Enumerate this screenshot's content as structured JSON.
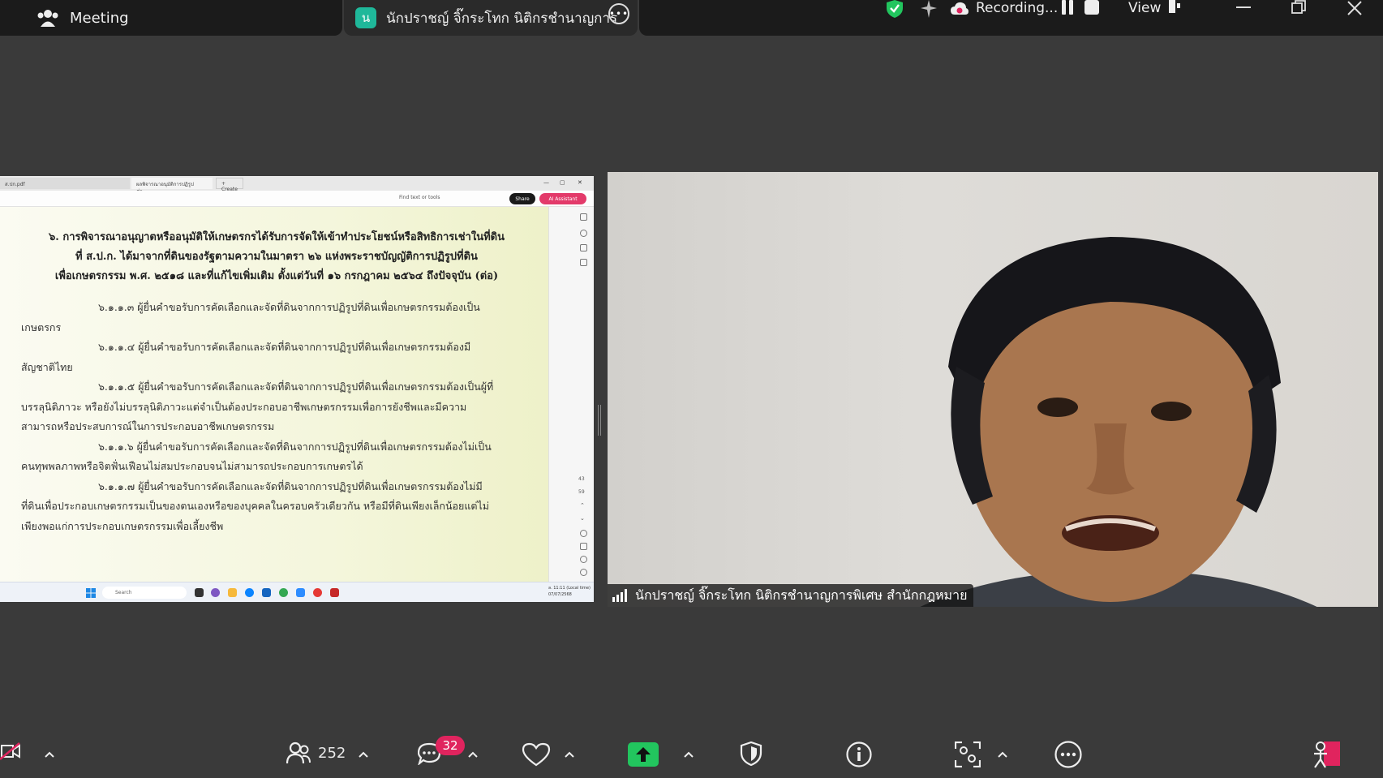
{
  "topbar": {
    "meeting_label": "Meeting",
    "speaker_avatar_letter": "น",
    "speaker_tab_name": "นักปราชญ์ จิ๊กระโทก นิติกรชำนาญการ",
    "recording_label": "Recording...",
    "view_label": "View"
  },
  "shared_screen": {
    "tabs": [
      "ส.ปก.pdf",
      "ผลพิจารณาอนุมัติการปฏิรูปที่ดิน...",
      "+ Create"
    ],
    "find_placeholder": "Find text or tools",
    "share_button": "Share",
    "ai_button": "AI Assistant",
    "heading_lines": [
      "๖. การพิจารณาอนุญาตหรืออนุมัติให้เกษตรกรได้รับการจัดให้เข้าทำประโยชน์หรือสิทธิการเช่าในที่ดิน",
      "ที่ ส.ป.ก. ได้มาจากที่ดินของรัฐตามความในมาตรา ๒๖ แห่งพระราชบัญญัติการปฏิรูปที่ดิน",
      "เพื่อเกษตรกรรม พ.ศ. ๒๕๑๘ และที่แก้ไขเพิ่มเติม ตั้งแต่วันที่ ๑๖ กรกฎาคม ๒๕๖๔ ถึงปัจจุบัน (ต่อ)"
    ],
    "paragraphs": [
      "๖.๑.๑.๓ ผู้ยื่นคำขอรับการคัดเลือกและจัดที่ดินจากการปฏิรูปที่ดินเพื่อเกษตรกรรมต้องเป็นเกษตรกร",
      "๖.๑.๑.๔ ผู้ยื่นคำขอรับการคัดเลือกและจัดที่ดินจากการปฏิรูปที่ดินเพื่อเกษตรกรรมต้องมีสัญชาติไทย",
      "๖.๑.๑.๕ ผู้ยื่นคำขอรับการคัดเลือกและจัดที่ดินจากการปฏิรูปที่ดินเพื่อเกษตรกรรมต้องเป็นผู้ที่บรรลุนิติภาวะ หรือยังไม่บรรลุนิติภาวะแต่จำเป็นต้องประกอบอาชีพเกษตรกรรมเพื่อการยังชีพและมีความสามารถหรือประสบการณ์ในการประกอบอาชีพเกษตรกรรม",
      "๖.๑.๑.๖ ผู้ยื่นคำขอรับการคัดเลือกและจัดที่ดินจากการปฏิรูปที่ดินเพื่อเกษตรกรรมต้องไม่เป็นคนทุพพลภาพหรือจิตฟั่นเฟือนไม่สมประกอบจนไม่สามารถประกอบการเกษตรได้",
      "๖.๑.๑.๗ ผู้ยื่นคำขอรับการคัดเลือกและจัดที่ดินจากการปฏิรูปที่ดินเพื่อเกษตรกรรมต้องไม่มีที่ดินเพื่อประกอบเกษตรกรรมเป็นของตนเองหรือของบุคคลในครอบครัวเดียวกัน หรือมีที่ดินเพียงเล็กน้อยแต่ไม่เพียงพอแก่การประกอบเกษตรกรรมเพื่อเลี้ยงชีพ"
    ],
    "page_current": "43",
    "page_total": "59",
    "taskbar_search": "Search",
    "clock_time": "ล. 11:11 (Local time)",
    "clock_date": "07/07/2568"
  },
  "camera": {
    "name_tag": "นักปราชญ์ จิ๊กระโทก นิติกรชำนาญการพิเศษ สำนักกฎหมาย"
  },
  "bottombar": {
    "participants_count": "252",
    "chat_badge": "32"
  },
  "colors": {
    "background": "#3a3a3a",
    "bar": "#1b1b1b",
    "avatar": "#1fb89a",
    "share_green": "#22c55e",
    "badge_red": "#e0245e",
    "secure_green": "#22c55e"
  },
  "icons": [
    "participants-icon",
    "chat-icon",
    "reactions-icon",
    "share-screen-icon",
    "security-icon",
    "info-icon",
    "apps-icon",
    "more-icon",
    "video-off-icon",
    "avatar-icon"
  ]
}
